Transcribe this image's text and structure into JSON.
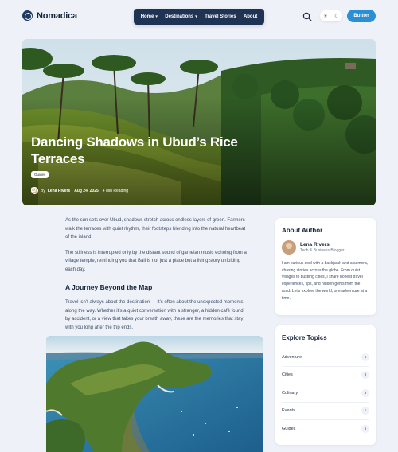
{
  "brand": {
    "name": "Nomadica"
  },
  "nav": {
    "items": [
      {
        "label": "Home",
        "has_dropdown": true
      },
      {
        "label": "Destinations",
        "has_dropdown": true
      },
      {
        "label": "Travel Stories",
        "has_dropdown": false
      },
      {
        "label": "About",
        "has_dropdown": false
      }
    ]
  },
  "header": {
    "search_icon": "search-icon",
    "theme_toggle": {
      "light_icon": "sun-icon",
      "dark_icon": "moon-icon"
    },
    "cta_label": "Button"
  },
  "hero": {
    "title": "Dancing Shadows in Ubud’s Rice Terraces",
    "tag": "Guides",
    "author_prefix": "By",
    "author": "Lena Rivers",
    "date": "Aug 24, 2025",
    "read_time": "4 Min Reading"
  },
  "article": {
    "paragraphs": [
      "As the sun sets over Ubud, shadows stretch across endless layers of green. Farmers walk the terraces with quiet rhythm, their footsteps blending into the natural heartbeat of the island.",
      "The stillness is interrupted only by the distant sound of gamelan music echoing from a village temple, reminding you that Bali is not just a place but a living story unfolding each day."
    ],
    "heading": "A Journey Beyond the Map",
    "paragraph_after": "Travel isn’t always about the destination — it’s often about the unexpected moments along the way. Whether it’s a quiet conversation with a stranger, a hidden café found by accident, or a view that takes your breath away, these are the memories that stay with you long after the trip ends."
  },
  "about_author": {
    "title": "About Author",
    "name": "Lena Rivers",
    "role": "Tech & Business Blogger",
    "bio": "I am curious soul with a backpack and a camera, chasing stories across the globe. From quiet villages to bustling cities, I share honest travel experiences, tips, and hidden gems from the road. Let’s explore the world, one adventure at a time."
  },
  "explore_topics": {
    "title": "Explore Topics",
    "items": [
      {
        "label": "Adventure",
        "count": "6"
      },
      {
        "label": "Cities",
        "count": "8"
      },
      {
        "label": "Culinary",
        "count": "3"
      },
      {
        "label": "Events",
        "count": "1"
      },
      {
        "label": "Guides",
        "count": "6"
      }
    ]
  },
  "colors": {
    "accent": "#2b8fd6",
    "nav_bg": "#1f3355",
    "page_bg": "#eef2f8"
  }
}
